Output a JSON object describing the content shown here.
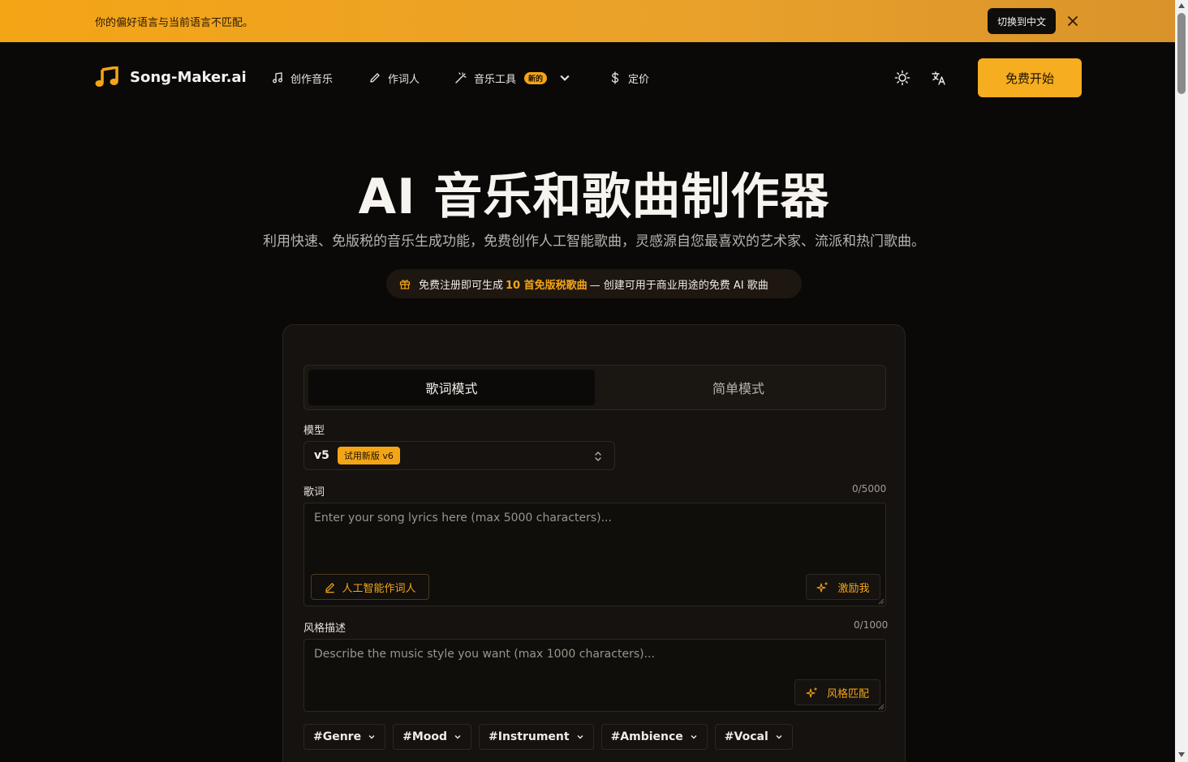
{
  "banner": {
    "message": "你的偏好语言与当前语言不匹配。",
    "switch_label": "切换到中文"
  },
  "nav": {
    "brand": "Song-Maker.ai",
    "items": [
      {
        "label": "创作音乐",
        "icon": "music-note-icon"
      },
      {
        "label": "作词人",
        "icon": "pen-icon"
      },
      {
        "label": "音乐工具",
        "icon": "magic-wand-icon",
        "badge": "新的"
      },
      {
        "label": "定价",
        "icon": "dollar-icon"
      }
    ],
    "cta": "免费开始"
  },
  "hero": {
    "title": "AI 音乐和歌曲制作器",
    "subtitle": "利用快速、免版税的音乐生成功能，免费创作人工智能歌曲，灵感源自您最喜欢的艺术家、流派和热门歌曲。",
    "promo_prefix": "免费注册即可生成",
    "promo_highlight": "10 首免版税歌曲",
    "promo_suffix": "— 创建可用于商业用途的免费 AI 歌曲"
  },
  "form": {
    "tabs": [
      {
        "label": "歌词模式",
        "active": true
      },
      {
        "label": "简单模式",
        "active": false
      }
    ],
    "model_label": "模型",
    "model_value": "v5",
    "model_badge": "试用新版 v6",
    "lyrics_label": "歌词",
    "lyrics_counter": "0/5000",
    "lyrics_placeholder": "Enter your song lyrics here (max 5000 characters)...",
    "ai_lyricist_label": "人工智能作词人",
    "inspire_label": "激励我",
    "style_label": "风格描述",
    "style_counter": "0/1000",
    "style_placeholder": "Describe the music style you want (max 1000 characters)...",
    "style_match_label": "风格匹配",
    "tags": [
      "#Genre",
      "#Mood",
      "#Instrument",
      "#Ambience",
      "#Vocal"
    ]
  },
  "colors": {
    "accent": "#f4a516",
    "background": "#0b0908",
    "card": "#15120f"
  }
}
